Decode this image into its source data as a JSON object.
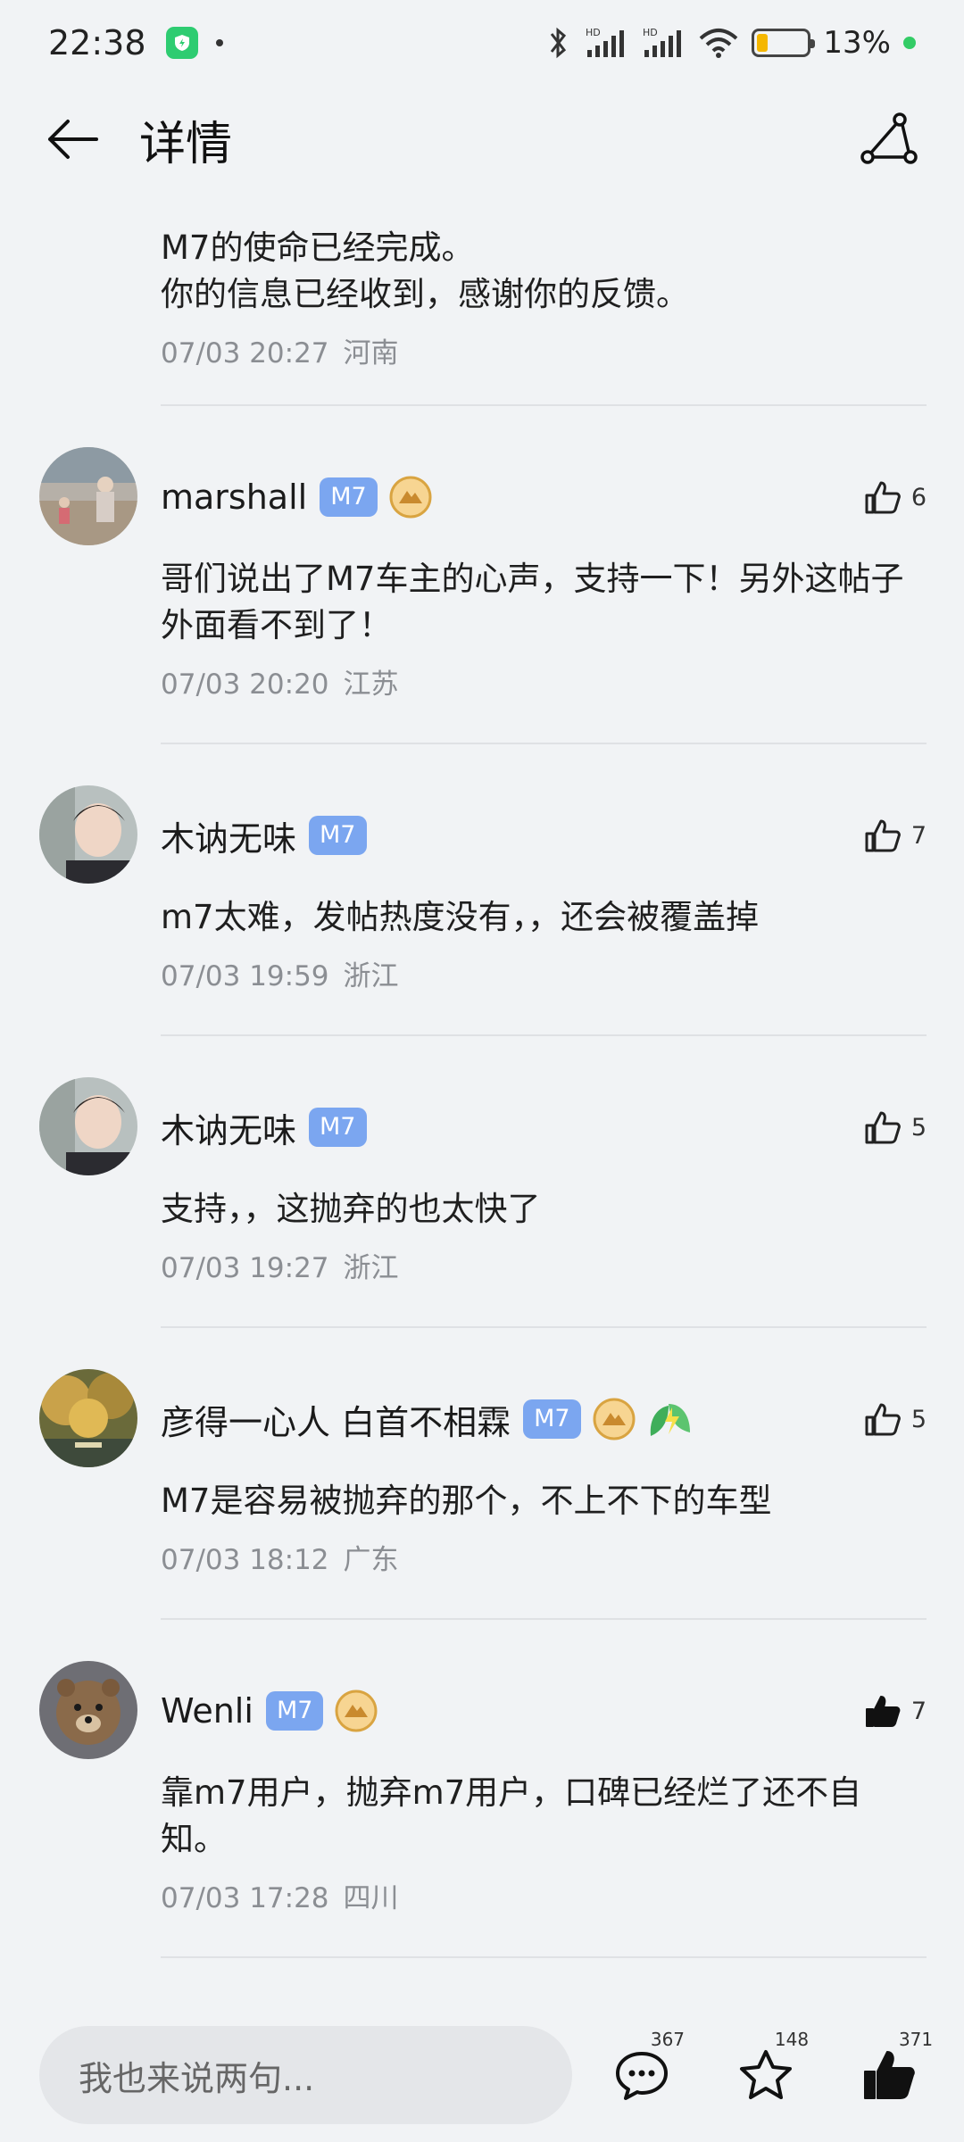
{
  "status": {
    "time": "22:38",
    "battery_text": "13%",
    "battery_level": 0.13
  },
  "header": {
    "title": "详情"
  },
  "top_comment": {
    "text_line1": "M7的使命已经完成。",
    "text_line2": "你的信息已经收到，感谢你的反馈。",
    "time": "07/03 20:27",
    "region": "河南"
  },
  "comments": [
    {
      "username": "marshall",
      "badge": "M7",
      "likes": "6",
      "text": "哥们说出了M7车主的心声，支持一下！另外这帖子外面看不到了！",
      "time": "07/03 20:20",
      "region": "江苏"
    },
    {
      "username": "木讷无味",
      "badge": "M7",
      "likes": "7",
      "text": "m7太难，发帖热度没有，，还会被覆盖掉",
      "time": "07/03 19:59",
      "region": "浙江"
    },
    {
      "username": "木讷无味",
      "badge": "M7",
      "likes": "5",
      "text": "支持，，这抛弃的也太快了",
      "time": "07/03 19:27",
      "region": "浙江"
    },
    {
      "username": "彦得一心人 白首不相霖",
      "badge": "M7",
      "likes": "5",
      "text": "M7是容易被抛弃的那个，不上不下的车型",
      "time": "07/03 18:12",
      "region": "广东"
    },
    {
      "username": "Wenli",
      "badge": "M7",
      "likes": "7",
      "text": "靠m7用户，抛弃m7用户，口碑已经烂了还不自知。",
      "time": "07/03 17:28",
      "region": "四川"
    }
  ],
  "bottom": {
    "placeholder": "我也来说两句...",
    "comment_count": "367",
    "favorite_count": "148",
    "like_count": "371"
  },
  "colors": {
    "background": "#f1f3f5",
    "badge": "#7ba6f0",
    "meta": "#8b8e93"
  }
}
